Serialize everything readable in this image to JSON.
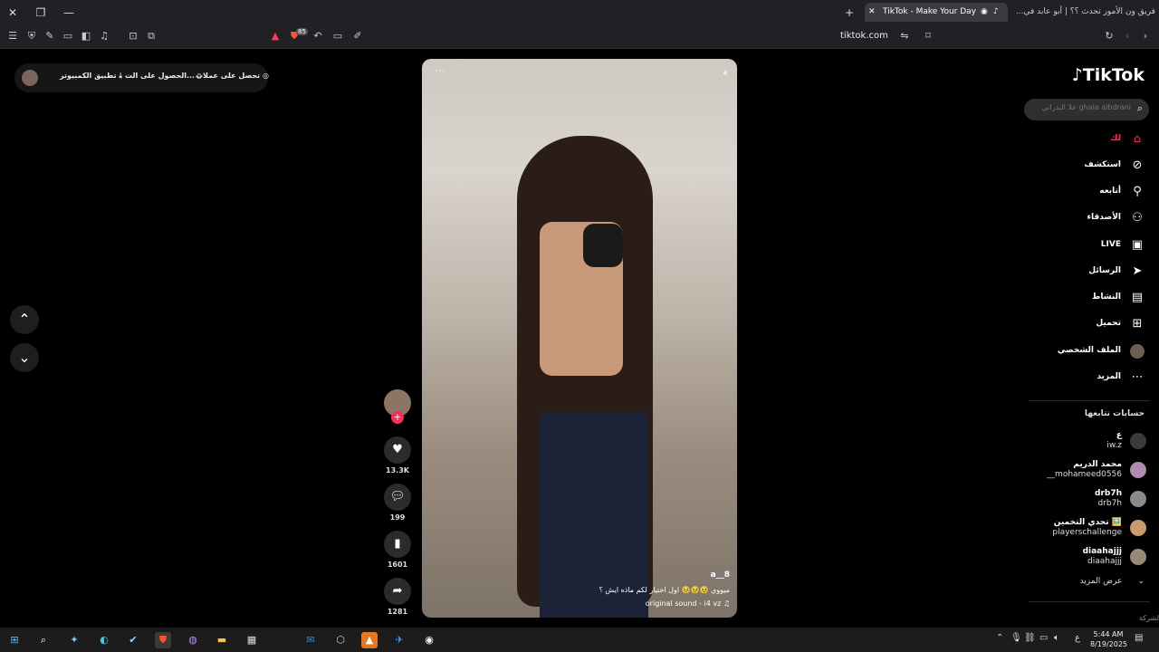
{
  "browser": {
    "tabs": [
      {
        "title": "TikTok - Make Your Day",
        "active": true
      },
      {
        "title": "فريق ون الأمور تحدث ؟؟ | أبو عابد في...",
        "active": false
      }
    ],
    "url": "tiktok.com",
    "brave_badge": "85"
  },
  "top_pill": {
    "get_coins": "تحصل على عملات",
    "get_app": "الحصول على الت...",
    "desktop_app": "تطبيق الكمبيوتر"
  },
  "video": {
    "author": "a__8",
    "caption": "ميووي 🥹🥹🥹 اول اختيار لكم ماذه ايش ؟",
    "sound": "original sound - i4 vz"
  },
  "actions": {
    "likes": "13.3K",
    "comments": "199",
    "saves": "1601",
    "shares": "1281"
  },
  "sidebar": {
    "logo": "TikTok",
    "search_placeholder": "ghala albdrani علا البدراني",
    "menu": [
      {
        "label": "لك",
        "icon": "home-icon"
      },
      {
        "label": "استكشف",
        "icon": "compass-icon"
      },
      {
        "label": "أتابعه",
        "icon": "following-icon"
      },
      {
        "label": "الأصدقاء",
        "icon": "friends-icon"
      },
      {
        "label": "LIVE",
        "icon": "live-icon"
      },
      {
        "label": "الرسائل",
        "icon": "messages-icon"
      },
      {
        "label": "النشاط",
        "icon": "activity-icon"
      },
      {
        "label": "تحميل",
        "icon": "upload-icon"
      },
      {
        "label": "الملف الشخصي",
        "icon": "profile-icon"
      },
      {
        "label": "المزيد",
        "icon": "more-icon"
      }
    ],
    "following_title": "حسابات تتابعها",
    "following": [
      {
        "name": "ع",
        "handle": "iw.z"
      },
      {
        "name": "محمد الدريم",
        "handle": "__mohameed0556"
      },
      {
        "name": "drb7h",
        "handle": "drb7h"
      },
      {
        "name": "تحدي التخمين 🖼️",
        "handle": "playerschallenge"
      },
      {
        "name": "diaahajjj",
        "handle": "diaahajjj"
      }
    ],
    "see_more": "عرض المزيد",
    "company": "الشركة"
  },
  "taskbar": {
    "time": "5:44 AM",
    "date": "8/19/2025",
    "lang": "ع"
  }
}
